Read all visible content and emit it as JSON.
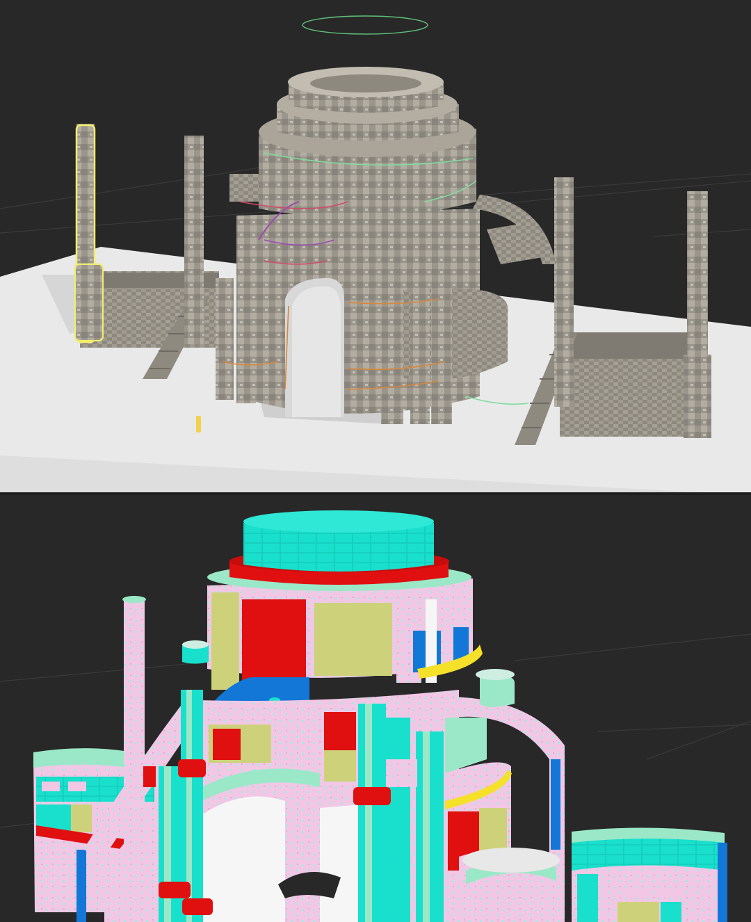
{
  "viewports": [
    {
      "id": "top",
      "mode": "textured-shaded"
    },
    {
      "id": "bottom",
      "mode": "material-id-colors"
    }
  ],
  "colors": {
    "background": "#282828",
    "grid": "#3a3a3a",
    "ground_plane": "#e9e9e9",
    "stone": "#9b968c",
    "stone_dark": "#7a766d",
    "selection_outline": "#f2ee6a",
    "spline_green": "#7fdca0",
    "spline_red": "#d24a6a",
    "spline_purple": "#9a4fb0",
    "spline_orange": "#d8873b",
    "id_cyan": "#19e0cc",
    "id_red": "#e01010",
    "id_khaki": "#cdd27a",
    "id_pink": "#f2c7e6",
    "id_mint": "#9be8c8",
    "id_blue": "#1277d6",
    "id_yellow": "#f5e02a",
    "id_white": "#f6f6f6"
  },
  "icons": [
    "helper-circle-icon",
    "light-marker-icon"
  ]
}
